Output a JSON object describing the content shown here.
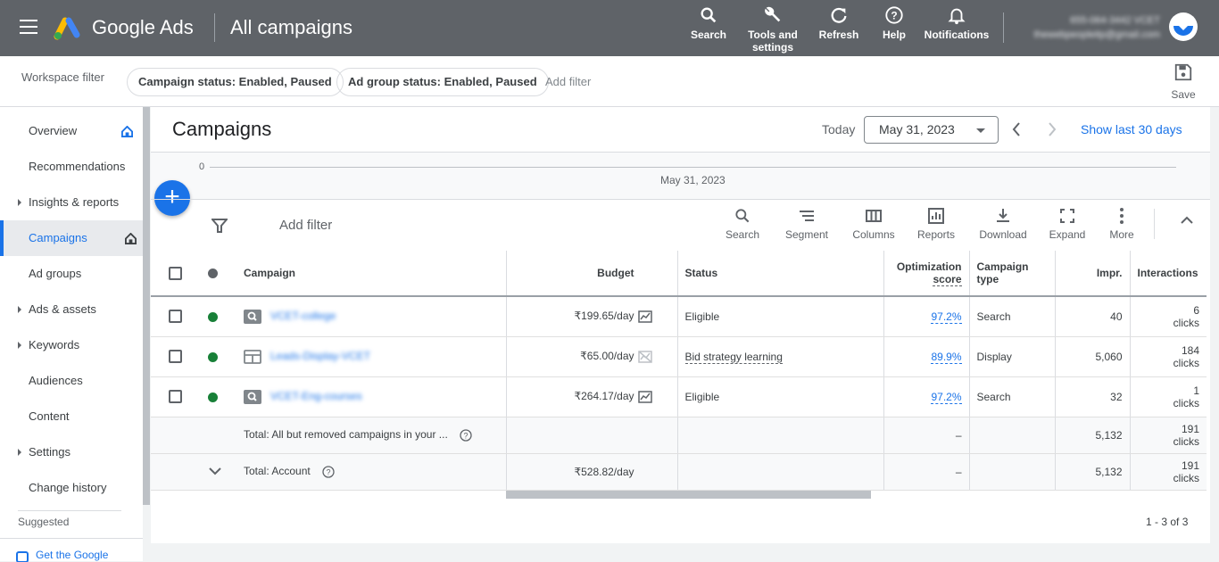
{
  "header": {
    "brand": "Google Ads",
    "page_title": "All campaigns",
    "tools": [
      {
        "label": "Search",
        "icon": "search-icon"
      },
      {
        "label": "Tools and settings",
        "icon": "wrench-icon"
      },
      {
        "label": "Refresh",
        "icon": "refresh-icon"
      },
      {
        "label": "Help",
        "icon": "help-icon"
      },
      {
        "label": "Notifications",
        "icon": "bell-icon"
      }
    ],
    "account_id": "655-064-3442 VCET",
    "account_email": "thewebpeopleitp@gmail.com"
  },
  "filterbar": {
    "label": "Workspace filter",
    "chips": [
      "Campaign status: Enabled, Paused",
      "Ad group status: Enabled, Paused"
    ],
    "add_filter": "Add filter",
    "save": "Save"
  },
  "sidebar": {
    "items": [
      "Overview",
      "Recommendations",
      "Insights & reports",
      "Campaigns",
      "Ad groups",
      "Ads & assets",
      "Keywords",
      "Audiences",
      "Content",
      "Settings",
      "Change history"
    ],
    "suggested": "Suggested",
    "get_app": "Get the Google"
  },
  "main": {
    "title": "Campaigns",
    "today_label": "Today",
    "date": "May 31, 2023",
    "show_last": "Show last 30 days",
    "chart_zero": "0",
    "chart_date": "May 31, 2023",
    "add_filter": "Add filter",
    "toolbar": [
      "Search",
      "Segment",
      "Columns",
      "Reports",
      "Download",
      "Expand",
      "More"
    ]
  },
  "table": {
    "headers": {
      "campaign": "Campaign",
      "budget": "Budget",
      "status": "Status",
      "opt_score_1": "Optimization",
      "opt_score_2": "score",
      "type_1": "Campaign",
      "type_2": "type",
      "impr": "Impr.",
      "interactions": "Interactions"
    },
    "rows": [
      {
        "name": "VCET-college",
        "budget": "₹199.65/day",
        "status": "Eligible",
        "score": "97.2%",
        "type": "Search",
        "impr": "40",
        "int_num": "6",
        "int_unit": "clicks"
      },
      {
        "name": "Leads-Display-VCET",
        "budget": "₹65.00/day",
        "status": "Bid strategy learning",
        "score": "89.9%",
        "type": "Display",
        "impr": "5,060",
        "int_num": "184",
        "int_unit": "clicks"
      },
      {
        "name": "VCET-Eng-courses",
        "budget": "₹264.17/day",
        "status": "Eligible",
        "score": "97.2%",
        "type": "Search",
        "impr": "32",
        "int_num": "1",
        "int_unit": "clicks"
      }
    ],
    "total1": {
      "label": "Total: All but removed campaigns in your ...",
      "score": "–",
      "impr": "5,132",
      "int_num": "191",
      "int_unit": "clicks"
    },
    "total2": {
      "label": "Total: Account",
      "budget": "₹528.82/day",
      "score": "–",
      "impr": "5,132",
      "int_num": "191",
      "int_unit": "clicks"
    }
  },
  "pager": "1 - 3 of 3",
  "colors": {
    "topbar": "#5f6368",
    "accent": "#1a73e8",
    "enabled": "#188038"
  }
}
